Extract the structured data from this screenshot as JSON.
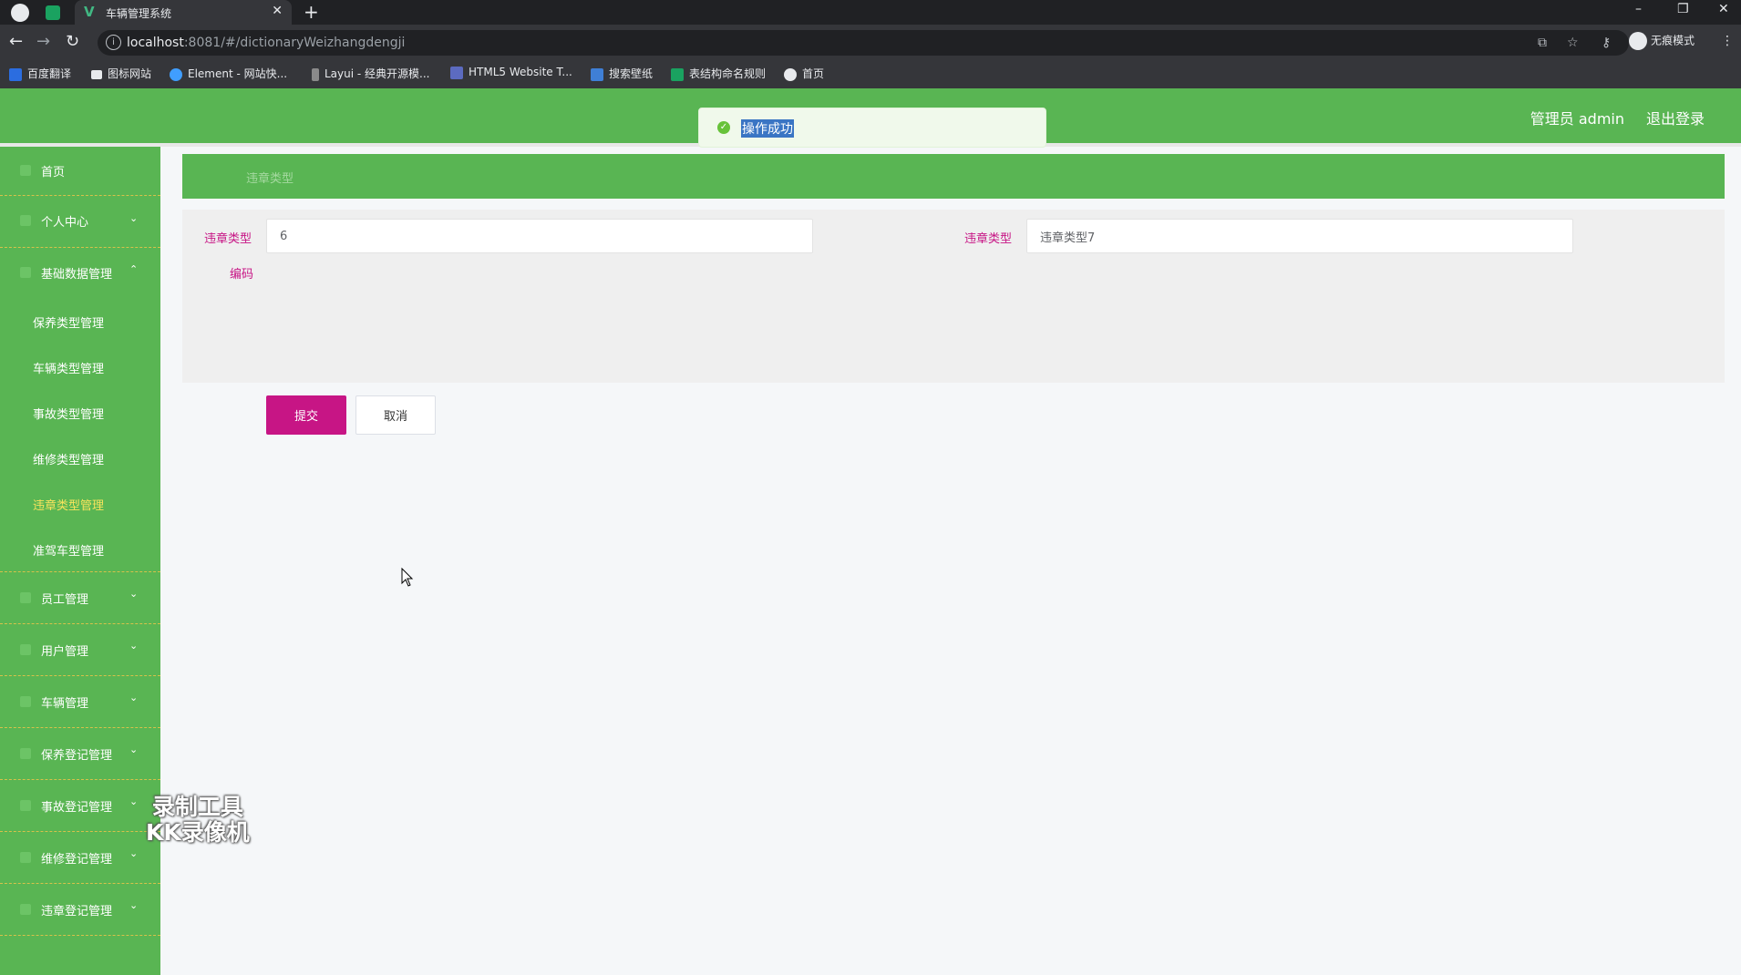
{
  "browser": {
    "tab_title": "车辆管理系统",
    "url_host": "localhost",
    "url_rest": ":8081/#/dictionaryWeizhangdengji",
    "incognito_label": "无痕模式",
    "bookmarks": [
      "百度翻译",
      "图标网站",
      "Element - 网站快...",
      "Layui - 经典开源模...",
      "HTML5 Website T...",
      "搜索壁纸",
      "表结构命名规则",
      "首页"
    ]
  },
  "header": {
    "user_label": "管理员 admin",
    "logout_label": "退出登录"
  },
  "toast": {
    "message": "操作成功",
    "color": "#67c23a"
  },
  "sidebar": {
    "home": "首页",
    "personal_center": "个人中心",
    "basic_data": "基础数据管理",
    "sub_items": [
      "保养类型管理",
      "车辆类型管理",
      "事故类型管理",
      "维修类型管理",
      "违章类型管理",
      "准驾车型管理"
    ],
    "active_sub": "违章类型管理",
    "groups": [
      "员工管理",
      "用户管理",
      "车辆管理",
      "保养登记管理",
      "事故登记管理",
      "维修登记管理",
      "违章登记管理"
    ]
  },
  "breadcrumb": "违章类型",
  "form": {
    "code_label_line1": "违章类型",
    "code_label_line2": "编码",
    "code_value": "6",
    "name_label": "违章类型",
    "name_value": "违章类型7",
    "submit_label": "提交",
    "cancel_label": "取消"
  },
  "watermark": {
    "line1": "录制工具",
    "line2": "KK录像机"
  },
  "colors": {
    "primary_green": "#59b553",
    "accent_magenta": "#c71585",
    "active_menu": "#f7e35c"
  }
}
